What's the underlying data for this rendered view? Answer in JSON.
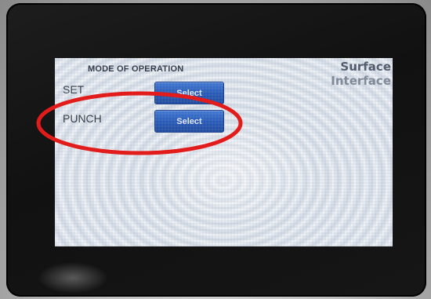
{
  "screen": {
    "mode_title": "MODE OF OPERATION",
    "brand_line1": "Surface",
    "brand_line2": "Interface",
    "rows": [
      {
        "label": "SET",
        "button": "Select"
      },
      {
        "label": "PUNCH",
        "button": "Select"
      }
    ]
  },
  "annotation": {
    "shape": "ellipse",
    "color": "#e21b1b",
    "encircles": "PUNCH row"
  }
}
